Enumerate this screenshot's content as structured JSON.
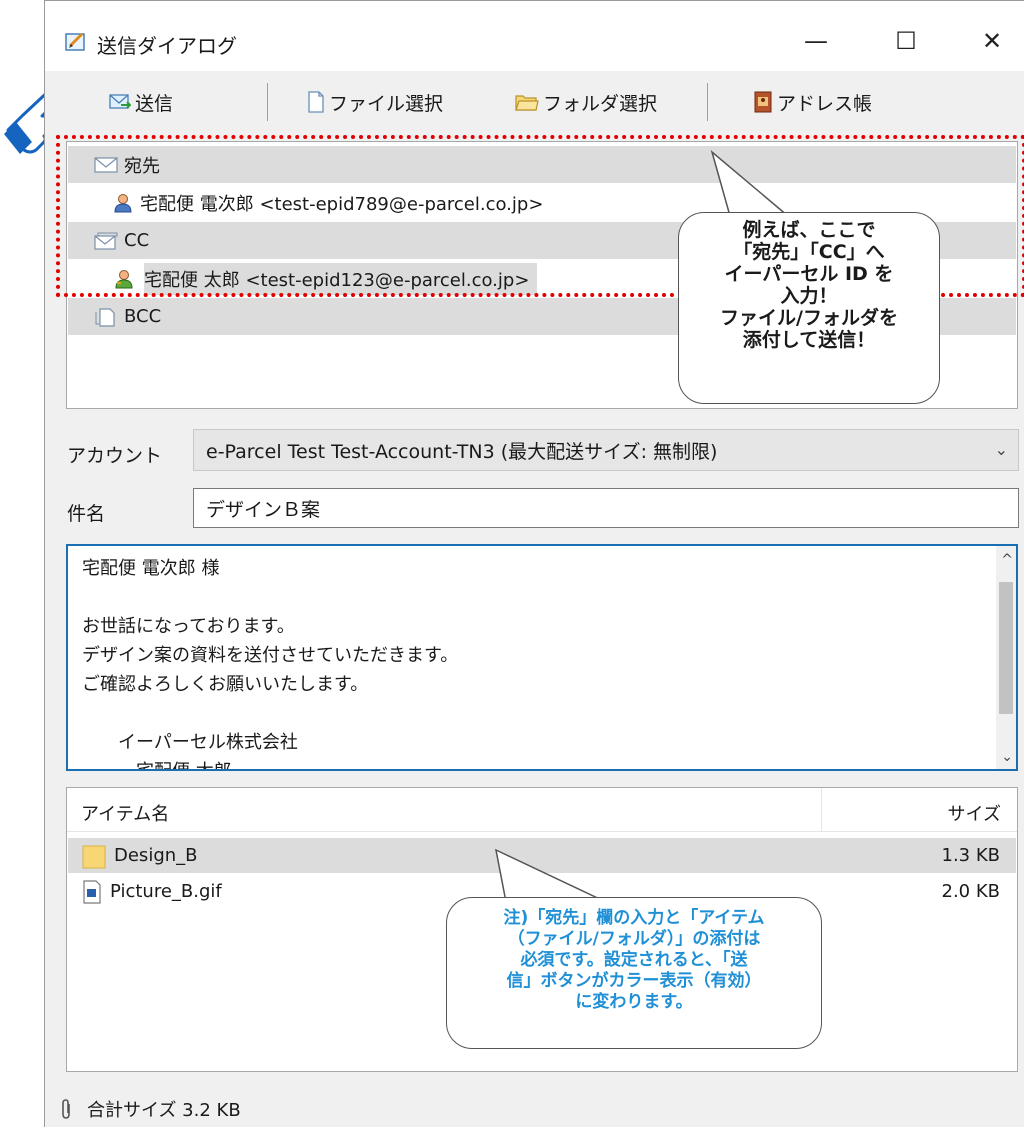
{
  "window": {
    "title": "送信ダイアログ",
    "minimize": "—",
    "maximize": "☐",
    "close": "✕"
  },
  "toolbar": {
    "send_label": "送信",
    "file_select_label": "ファイル選択",
    "folder_select_label": "フォルダ選択",
    "address_book_label": "アドレス帳"
  },
  "recipients": {
    "to_label": "宛先",
    "to_entries": [
      "宅配便 電次郎 <test-epid789@e-parcel.co.jp>"
    ],
    "cc_label": "CC",
    "cc_entries": [
      "宅配便 太郎 <test-epid123@e-parcel.co.jp>"
    ],
    "bcc_label": "BCC"
  },
  "form": {
    "account_label": "アカウント",
    "account_value": "e-Parcel Test Test-Account-TN3 (最大配送サイズ: 無制限)",
    "subject_label": "件名",
    "subject_value": "デザインＢ案"
  },
  "body_text": "宅配便 電次郎 様\n\nお世話になっております。\nデザイン案の資料を送付させていただきます。\nご確認よろしくお願いいたします。\n\n　　イーパーセル株式会社\n　　　宅配便 太郎",
  "items": {
    "col_name": "アイテム名",
    "col_size": "サイズ",
    "rows": [
      {
        "name": "Design_B",
        "size": "1.3 KB",
        "icon": "folder-icon"
      },
      {
        "name": "Picture_B.gif",
        "size": "2.0 KB",
        "icon": "gif-file-icon"
      }
    ]
  },
  "status": {
    "total_size": "合計サイズ 3.2 KB"
  },
  "callouts": {
    "top": [
      "例えば、ここで",
      "「宛先」「CC」へ",
      "イーパーセル ID を",
      "入力！",
      "ファイル/フォルダを",
      "添付して送信！"
    ],
    "bottom": [
      "注)「宛先」欄の入力と「アイテム",
      "（ファイル/フォルダ）」の添付は",
      "必須です。設定されると、「送",
      "信」ボタンがカラー表示（有効）",
      "に変わります。"
    ]
  },
  "colors": {
    "window_bg": "#f0f0f0",
    "group_row_bg": "#dcdcdc",
    "highlight_border": "#e00000",
    "body_border": "#1a6fb3",
    "note_text": "#1f8fd6",
    "pointer_hand": "#1565c0"
  }
}
